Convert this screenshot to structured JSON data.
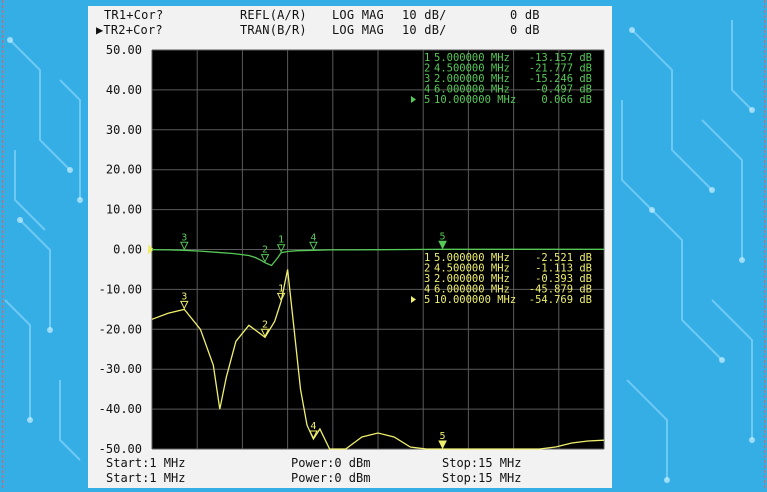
{
  "header": {
    "tr1": {
      "trace": "TR1+Cor?",
      "meas": "REFL(A/R)",
      "format": "LOG MAG",
      "scale": "10 dB/",
      "ref": "0 dB"
    },
    "tr2": {
      "trace": "▶TR2+Cor?",
      "meas": "TRAN(B/R)",
      "format": "LOG MAG",
      "scale": "10 dB/",
      "ref": "0 dB"
    }
  },
  "footer": {
    "row1": {
      "start": "Start:1 MHz",
      "power": "Power:0 dBm",
      "stop": "Stop:15 MHz"
    },
    "row2": {
      "start": "Start:1 MHz",
      "power": "Power:0 dBm",
      "stop": "Stop:15 MHz"
    }
  },
  "colors": {
    "refl": "#56c956",
    "tran": "#efef6e",
    "grid": "#5a5a5a",
    "screen": "#000000",
    "ticks": "#111111",
    "background": "#35aee6"
  },
  "chart_data": {
    "type": "line",
    "xlim": [
      1,
      15
    ],
    "ylim": [
      -50,
      50
    ],
    "yticks": [
      "50.00",
      "40.00",
      "30.00",
      "20.00",
      "10.00",
      "0.00",
      "-10.00",
      "-20.00",
      "-30.00",
      "-40.00",
      "-50.00"
    ],
    "grid": true,
    "series": [
      {
        "name": "TR1 REFL(A/R)",
        "color": "#56c956",
        "x": [
          1.0,
          1.5,
          2.0,
          2.5,
          3.0,
          3.5,
          4.0,
          4.2,
          4.4,
          4.5,
          4.7,
          4.9,
          5.0,
          5.2,
          5.5,
          6.0,
          6.5,
          7.0,
          8.0,
          9.0,
          10.0,
          11.0,
          12.0,
          13.0,
          14.0,
          15.0
        ],
        "y": [
          -0.05,
          -0.1,
          -0.2,
          -0.4,
          -0.7,
          -1.0,
          -1.5,
          -2.0,
          -2.8,
          -3.3,
          -4.0,
          -2.0,
          -0.8,
          -0.5,
          -0.3,
          -0.2,
          -0.1,
          -0.1,
          -0.05,
          0,
          0.05,
          0.05,
          0.05,
          0.05,
          0.05,
          0.05
        ],
        "markers": [
          {
            "id": "1",
            "freq": "5.000000 MHz",
            "value": "-13.157 dB"
          },
          {
            "id": "2",
            "freq": "4.500000 MHz",
            "value": "-21.777 dB"
          },
          {
            "id": "3",
            "freq": "2.000000 MHz",
            "value": "-15.246 dB"
          },
          {
            "id": "4",
            "freq": "6.000000 MHz",
            "value": "-0.497 dB"
          },
          {
            "id": "5",
            "freq": "10.000000 MHz",
            "value": "0.066 dB",
            "active": true
          }
        ]
      },
      {
        "name": "TR2 TRAN(B/R)",
        "color": "#efef6e",
        "x": [
          1.0,
          1.5,
          2.0,
          2.5,
          2.9,
          3.1,
          3.3,
          3.6,
          4.0,
          4.5,
          4.8,
          5.0,
          5.2,
          5.4,
          5.6,
          5.8,
          6.0,
          6.2,
          6.5,
          7.0,
          7.5,
          8.0,
          8.5,
          9.0,
          9.5,
          10.0,
          10.5,
          11.0,
          11.5,
          12.0,
          12.5,
          13.0,
          13.5,
          14.0,
          14.5,
          15.0
        ],
        "y": [
          -17.5,
          -16.0,
          -15.0,
          -20.0,
          -29.0,
          -40.0,
          -32.0,
          -23.0,
          -19.0,
          -22.0,
          -18.0,
          -13.0,
          -5.0,
          -20.0,
          -35.0,
          -44.0,
          -47.5,
          -45.0,
          -50.0,
          -50.0,
          -47.0,
          -46.0,
          -47.0,
          -49.5,
          -50.0,
          -50.0,
          -50.0,
          -50.0,
          -50.0,
          -50.0,
          -50.0,
          -50.0,
          -49.5,
          -48.5,
          -48.0,
          -47.8
        ],
        "markers": [
          {
            "id": "1",
            "freq": "5.000000 MHz",
            "value": "-2.521 dB"
          },
          {
            "id": "2",
            "freq": "4.500000 MHz",
            "value": "-1.113 dB"
          },
          {
            "id": "3",
            "freq": "2.000000 MHz",
            "value": "-0.393 dB"
          },
          {
            "id": "4",
            "freq": "6.000000 MHz",
            "value": "-45.879 dB"
          },
          {
            "id": "5",
            "freq": "10.000000 MHz",
            "value": "-54.769 dB",
            "active": true
          }
        ]
      }
    ]
  }
}
